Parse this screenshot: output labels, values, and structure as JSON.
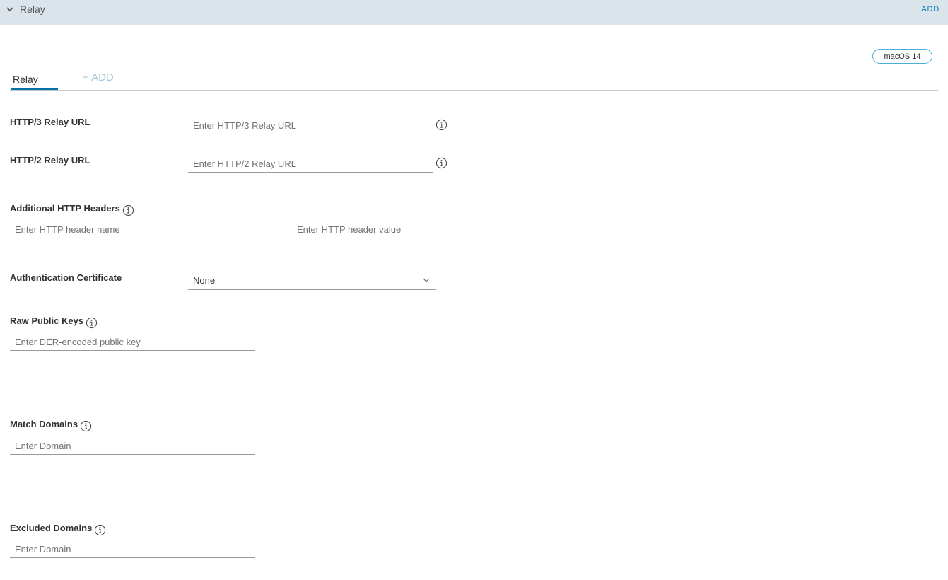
{
  "section": {
    "title": "Relay",
    "add_label": "ADD"
  },
  "badge": {
    "os": "macOS 14"
  },
  "tabs": {
    "active": "Relay",
    "add": "+ ADD"
  },
  "fields": {
    "http3": {
      "label": "HTTP/3 Relay URL",
      "placeholder": "Enter HTTP/3 Relay URL",
      "value": ""
    },
    "http2": {
      "label": "HTTP/2 Relay URL",
      "placeholder": "Enter HTTP/2 Relay URL",
      "value": ""
    },
    "headers": {
      "label": "Additional HTTP Headers",
      "name_placeholder": "Enter HTTP header name",
      "value_placeholder": "Enter HTTP header value"
    },
    "auth_cert": {
      "label": "Authentication Certificate",
      "selected": "None"
    },
    "raw_keys": {
      "label": "Raw Public Keys",
      "placeholder": "Enter DER-encoded public key"
    },
    "match_domains": {
      "label": "Match Domains",
      "placeholder": "Enter Domain"
    },
    "excluded_domains": {
      "label": "Excluded Domains",
      "placeholder": "Enter Domain"
    }
  },
  "colors": {
    "accent": "#0072a3",
    "header_bg": "#dbe4ea",
    "link": "#0079b8",
    "badge_border": "#49afd9"
  },
  "icons": {
    "collapse": "chevron-down-icon",
    "info": "info-icon",
    "select": "chevron-down-icon"
  }
}
